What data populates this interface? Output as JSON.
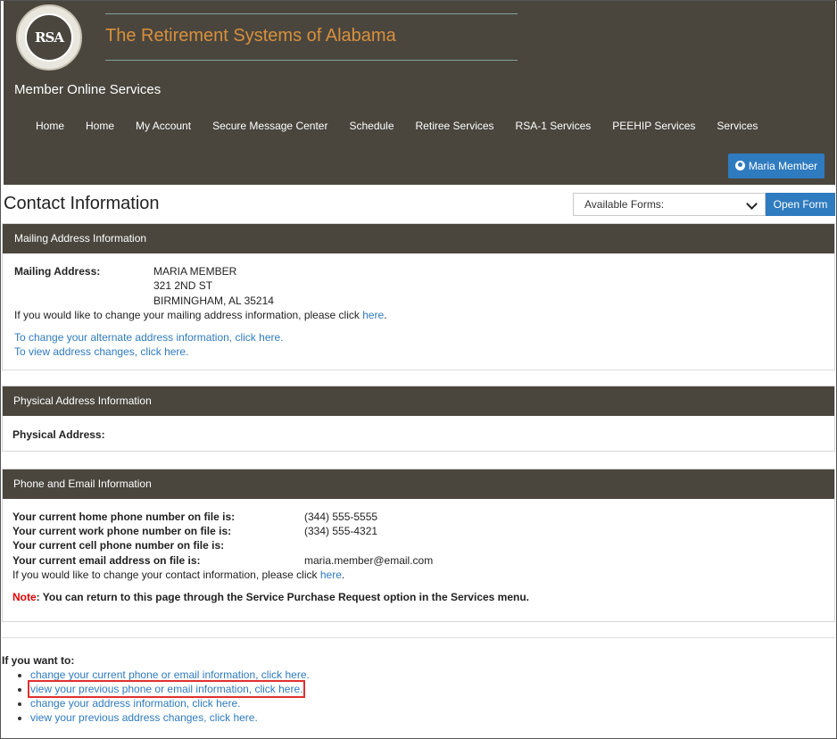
{
  "header": {
    "logo_text": "RSA",
    "logo_ring_text": "THE RETIREMENT SYSTEMS OF ALABAMA",
    "site_title": "The Retirement Systems of Alabama",
    "app_name": "Member Online Services",
    "nav": [
      "Home",
      "Home",
      "My Account",
      "Secure Message Center",
      "Schedule",
      "Retiree Services",
      "RSA-1 Services",
      "PEEHIP Services",
      "Services"
    ],
    "user_button": "Maria Member"
  },
  "page": {
    "title": "Contact Information",
    "forms_placeholder": "Available Forms:",
    "open_form": "Open Form"
  },
  "mailing": {
    "heading": "Mailing Address Information",
    "label": "Mailing Address:",
    "lines": [
      "MARIA MEMBER",
      "321 2ND ST",
      "BIRMINGHAM, AL 35214"
    ],
    "change_text": "If you would like to change your mailing address information, please click ",
    "change_link": "here",
    "alt_link": "To change your alternate address information, click here.",
    "view_link": "To view address changes, click here."
  },
  "physical": {
    "heading": "Physical Address Information",
    "label": "Physical Address:"
  },
  "phone": {
    "heading": "Phone and Email Information",
    "rows": [
      {
        "label": "Your current home phone number on file is:",
        "value": "(344) 555-5555"
      },
      {
        "label": "Your current work phone number on file is:",
        "value": "(334) 555-4321"
      },
      {
        "label": "Your current cell phone number on file is:",
        "value": ""
      },
      {
        "label": "Your current email address on file is:",
        "value": "maria.member@email.com"
      }
    ],
    "change_text": "If you would like to change your contact information, please click ",
    "change_link": "here",
    "note_label": "Note",
    "note_text": ": You can return to this page through the Service Purchase Request option in the Services menu."
  },
  "want": {
    "heading": "If you want to:",
    "items": [
      "change your current phone or email information, click here.",
      "view your previous phone or email information, click here.",
      "change your address information, click here.",
      "view your previous address changes, click here."
    ]
  },
  "colors": {
    "header_bg": "#4a463e",
    "accent_blue": "#2f7bbf",
    "title_orange": "#d9903c",
    "highlight_red": "#e03030"
  }
}
